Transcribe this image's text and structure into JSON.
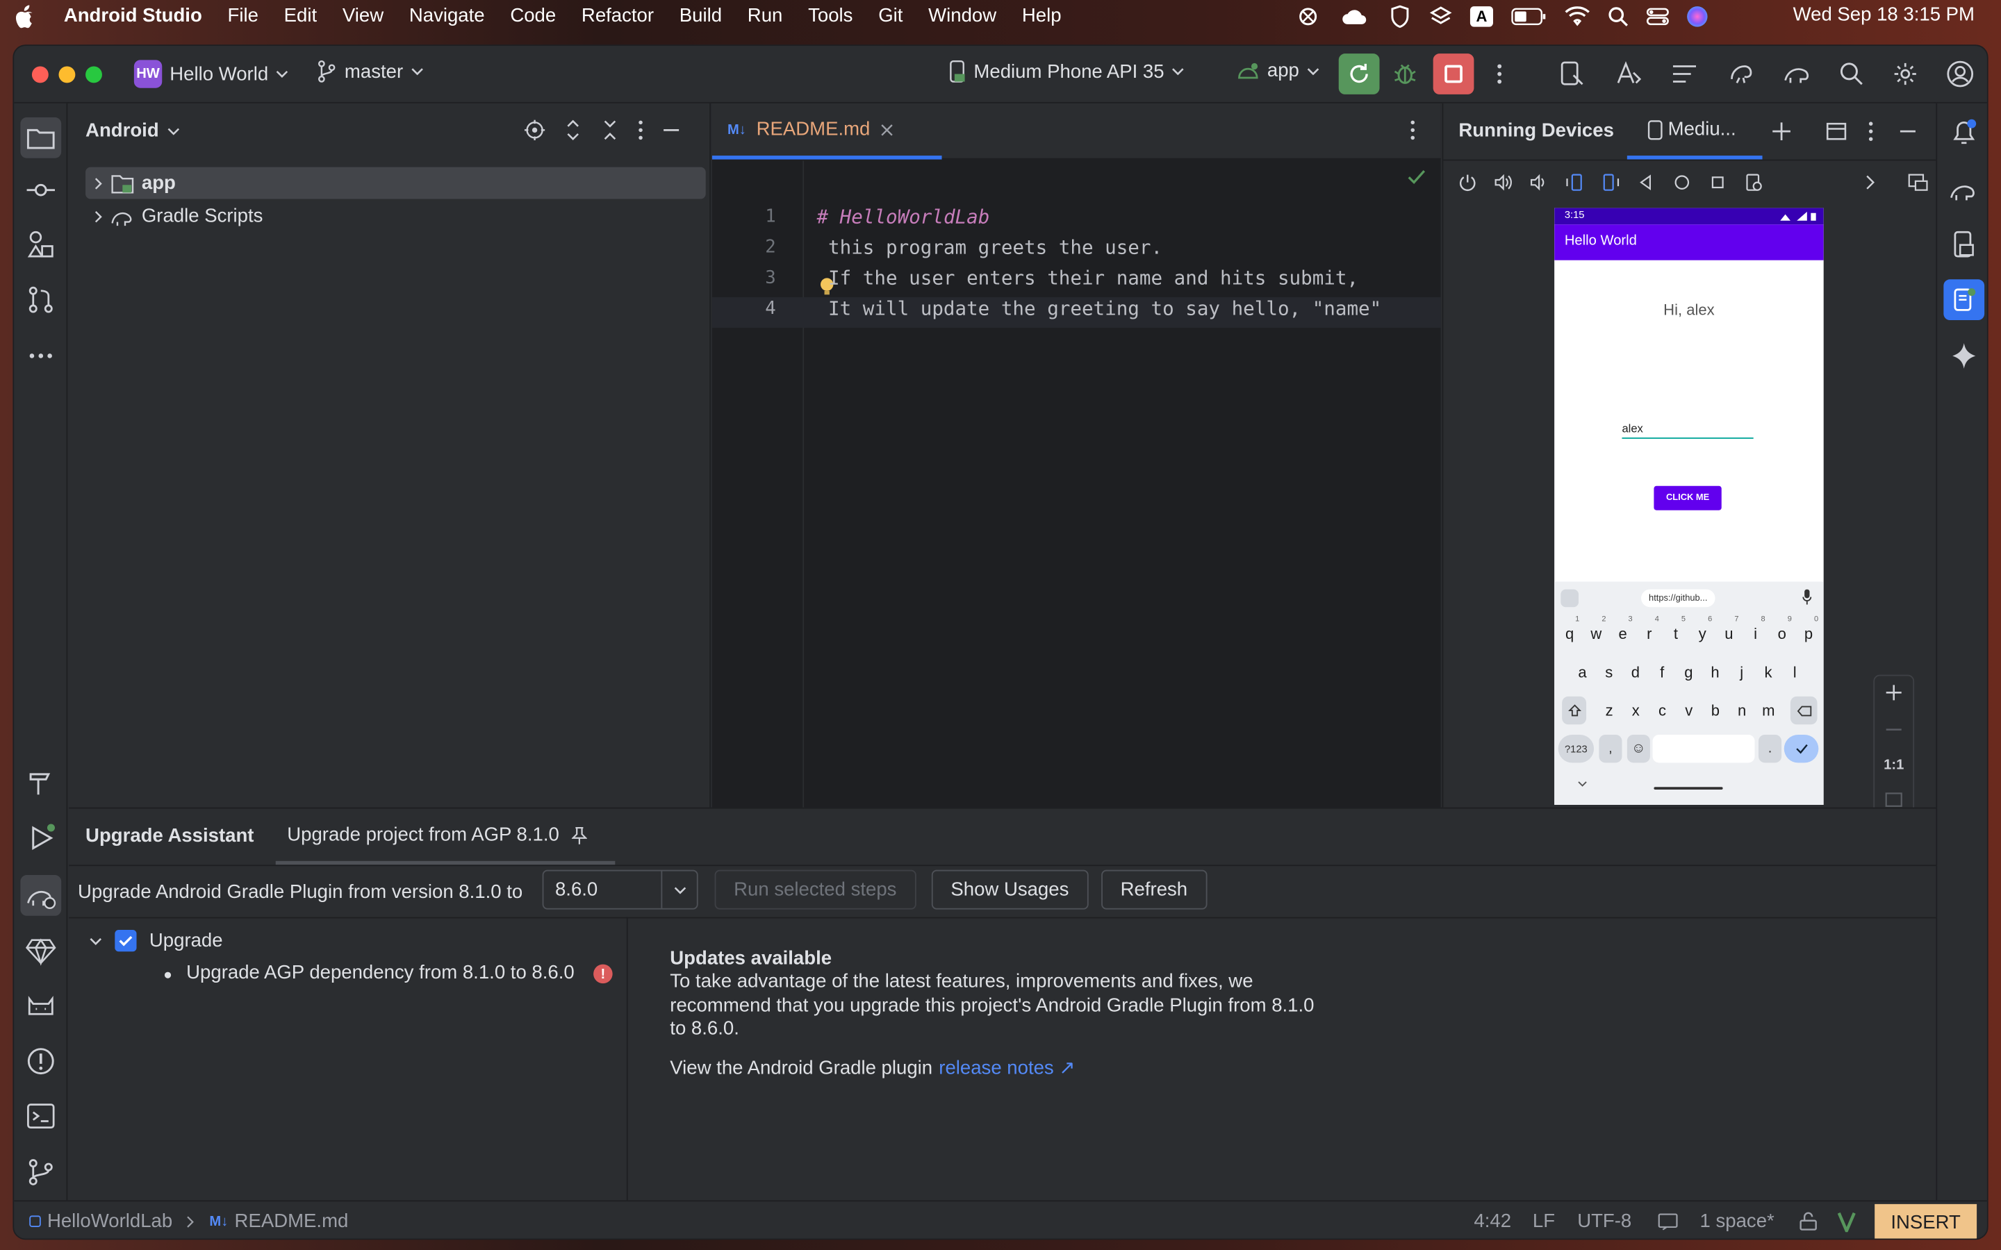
{
  "menubar": {
    "app_name": "Android Studio",
    "items": [
      "File",
      "Edit",
      "View",
      "Navigate",
      "Code",
      "Refactor",
      "Build",
      "Run",
      "Tools",
      "Git",
      "Window",
      "Help"
    ],
    "datetime": "Wed Sep 18  3:15 PM",
    "input_source": "A"
  },
  "titlebar": {
    "project_badge": "HW",
    "project_name": "Hello World",
    "branch": "master",
    "device": "Medium Phone API 35",
    "run_config": "app"
  },
  "project_panel": {
    "title": "Android",
    "tree": [
      {
        "label": "app"
      },
      {
        "label": "Gradle Scripts"
      }
    ]
  },
  "editor": {
    "tab": {
      "icon_text": "M↓",
      "name": "README.md"
    },
    "lines": [
      {
        "num": "1",
        "text": "# HelloWorldLab"
      },
      {
        "num": "2",
        "text": "this program greets the user."
      },
      {
        "num": "3",
        "text": "If the user enters their name and hits submit,"
      },
      {
        "num": "4",
        "text": "It will update the greeting to say hello, \"name\""
      }
    ]
  },
  "devices_panel": {
    "title": "Running Devices",
    "tab": "Mediu...",
    "zoom_label": "1:1",
    "phone": {
      "status_time": "3:15",
      "app_title": "Hello World",
      "greeting": "Hi, alex",
      "input_value": "alex",
      "button": "CLICK ME",
      "url_chip": "https://github...",
      "keyboard": {
        "row1": [
          "q",
          "w",
          "e",
          "r",
          "t",
          "y",
          "u",
          "i",
          "o",
          "p"
        ],
        "row1_hints": [
          "1",
          "2",
          "3",
          "4",
          "5",
          "6",
          "7",
          "8",
          "9",
          "0"
        ],
        "row2": [
          "a",
          "s",
          "d",
          "f",
          "g",
          "h",
          "j",
          "k",
          "l"
        ],
        "row3": [
          "z",
          "x",
          "c",
          "v",
          "b",
          "n",
          "m"
        ],
        "sym": "?123",
        "comma": ",",
        "period": "."
      }
    }
  },
  "bottom_panel": {
    "tabs": [
      "Upgrade Assistant",
      "Upgrade project from AGP 8.1.0"
    ],
    "prompt": "Upgrade Android Gradle Plugin from version 8.1.0 to",
    "version_value": "8.6.0",
    "buttons": {
      "run": "Run selected steps",
      "show_usages": "Show Usages",
      "refresh": "Refresh"
    },
    "tree": {
      "root": "Upgrade",
      "root_checked": true,
      "child": "Upgrade AGP dependency from 8.1.0 to 8.6.0"
    },
    "details": {
      "heading": "Updates available",
      "body": "To take advantage of the latest features, improvements and fixes, we recommend that you upgrade this project's Android Gradle Plugin from 8.1.0 to 8.6.0.",
      "link_prefix": "View the Android Gradle plugin",
      "link_text": "release notes ↗"
    }
  },
  "statusbar": {
    "breadcrumb_project": "HelloWorldLab",
    "breadcrumb_file": "README.md",
    "position": "4:42",
    "line_sep": "LF",
    "encoding": "UTF-8",
    "indent": "1 space*",
    "mode": "INSERT"
  },
  "colors": {
    "accent": "#3574f0",
    "run_green": "#57965c",
    "stop_red": "#db5c5c",
    "phone_purple": "#6200ee",
    "link": "#548af7"
  }
}
